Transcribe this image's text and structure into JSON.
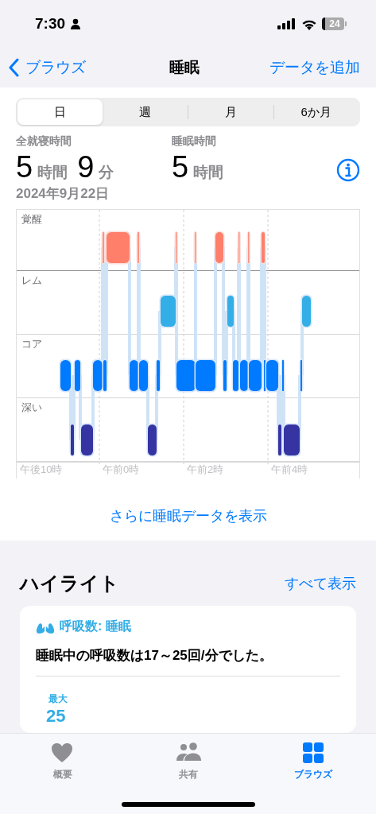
{
  "status_bar": {
    "time": "7:30",
    "battery": "24"
  },
  "nav": {
    "back": "ブラウズ",
    "title": "睡眠",
    "action": "データを追加"
  },
  "range_tabs": [
    {
      "label": "日",
      "selected": true
    },
    {
      "label": "週",
      "selected": false
    },
    {
      "label": "月",
      "selected": false
    },
    {
      "label": "6か月",
      "selected": false
    }
  ],
  "summary": [
    {
      "label": "全就寝時間",
      "parts": [
        {
          "value": "5",
          "unit": "時間"
        },
        {
          "value": "9",
          "unit": "分"
        }
      ]
    },
    {
      "label": "睡眠時間",
      "parts": [
        {
          "value": "5",
          "unit": "時間"
        }
      ]
    }
  ],
  "date": "2024年9月22日",
  "chart": {
    "stages": [
      "覚醒",
      "レム",
      "コア",
      "深い"
    ],
    "time_labels": [
      "午後10時",
      "午前0時",
      "午前2時",
      "午前4時"
    ]
  },
  "more_link": "さらに睡眠データを表示",
  "highlights": {
    "title": "ハイライト",
    "show_all": "すべて表示",
    "card": {
      "title": "呼吸数: 睡眠",
      "text": "睡眠中の呼吸数は17～25回/分でした。",
      "stat_label": "最大",
      "stat_value": "25"
    }
  },
  "tab_bar": [
    {
      "label": "概要",
      "kind": "heart",
      "selected": false
    },
    {
      "label": "共有",
      "kind": "people",
      "selected": false
    },
    {
      "label": "ブラウズ",
      "kind": "grid",
      "selected": true
    }
  ]
}
